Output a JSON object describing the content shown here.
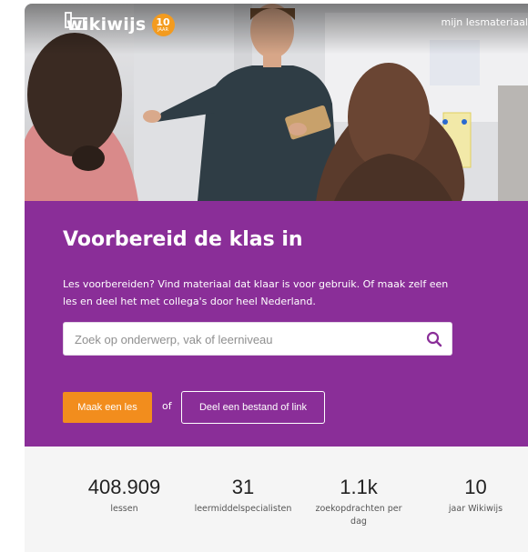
{
  "header": {
    "logo_text": "wikiwijs",
    "badge_number": "10",
    "badge_text": "JAAR",
    "top_link": "mijn lesmateriaal"
  },
  "hero": {
    "title": "Voorbereid de klas in",
    "intro": "Les voorbereiden? Vind materiaal dat klaar is voor gebruik. Of maak zelf een les en deel het met collega's door heel Nederland.",
    "search_placeholder": "Zoek op onderwerp, vak of leerniveau",
    "primary_button": "Maak een les",
    "or_text": "of",
    "secondary_button": "Deel een bestand of link"
  },
  "stats": [
    {
      "value": "408.909",
      "label": "lessen"
    },
    {
      "value": "31",
      "label": "leermiddelspecialisten"
    },
    {
      "value": "1.1k",
      "label": "zoekopdrachten per dag"
    },
    {
      "value": "10",
      "label": "jaar Wikiwijs"
    }
  ],
  "colors": {
    "purple": "#8a2e98",
    "orange": "#f28d1d",
    "badge": "#f39b1f"
  }
}
